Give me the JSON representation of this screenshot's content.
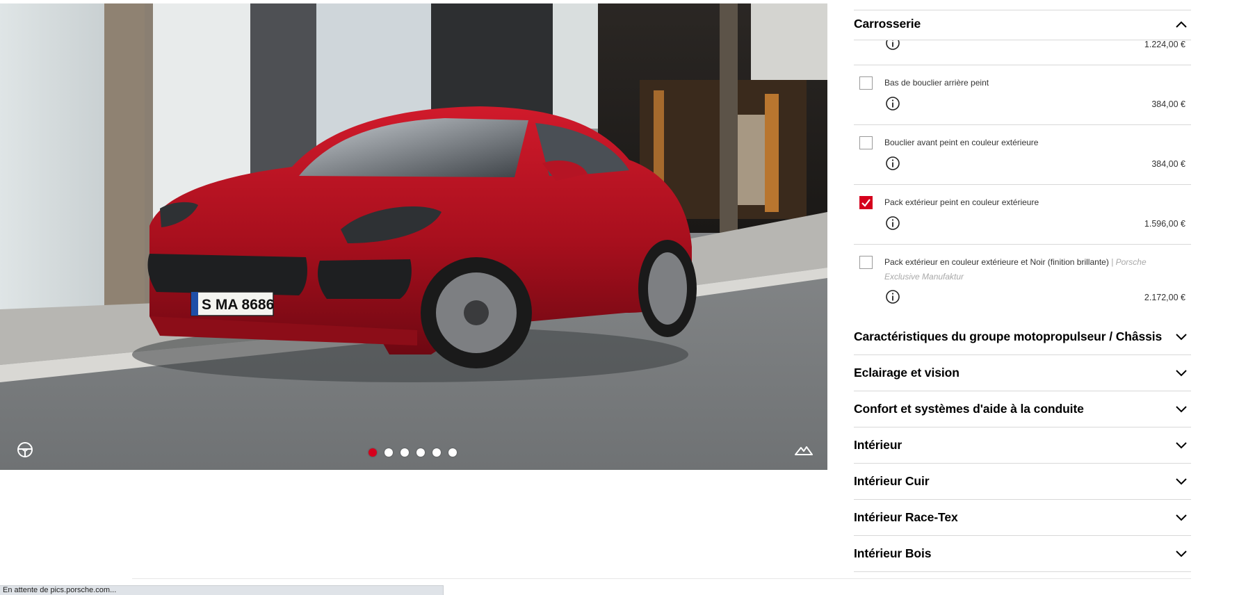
{
  "gallery": {
    "license_plate": "S MA 8686",
    "active_slide": 1,
    "slide_count": 6,
    "interior_icon": "steering-wheel-icon",
    "landscape_icon": "landscape-icon",
    "accent_color": "#d5001c"
  },
  "panel": {
    "open_section": {
      "label": "Carrosserie",
      "icon": "chevron-up-icon",
      "top_price_partial": "1.224,00 €",
      "options": [
        {
          "label": "Bas de bouclier arrière peint",
          "note": "",
          "price": "384,00 €",
          "checked": false
        },
        {
          "label": "Bouclier avant peint en couleur extérieure",
          "note": "",
          "price": "384,00 €",
          "checked": false
        },
        {
          "label": "Pack extérieur peint en couleur extérieure",
          "note": "",
          "price": "1.596,00 €",
          "checked": true
        },
        {
          "label": "Pack extérieur en couleur extérieure et Noir (finition brillante)",
          "note": "| Porsche Exclusive Manufaktur",
          "price": "2.172,00 €",
          "checked": false
        }
      ]
    },
    "sections": [
      {
        "label": "Caractéristiques du groupe motopropulseur / Châssis"
      },
      {
        "label": "Eclairage et vision"
      },
      {
        "label": "Confort et systèmes d'aide à la conduite"
      },
      {
        "label": "Intérieur"
      },
      {
        "label": "Intérieur Cuir"
      },
      {
        "label": "Intérieur Race-Tex"
      },
      {
        "label": "Intérieur Bois"
      }
    ]
  },
  "status_bar": {
    "text": "En attente de pics.porsche.com..."
  }
}
